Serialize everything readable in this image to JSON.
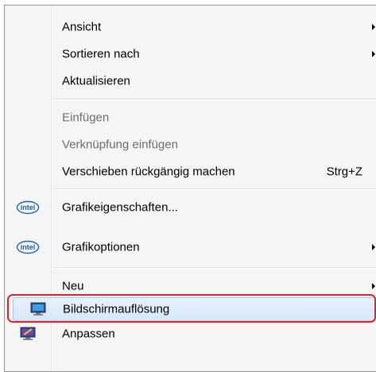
{
  "menu": {
    "items": [
      {
        "label": "Ansicht",
        "submenu": true
      },
      {
        "label": "Sortieren nach",
        "submenu": true
      },
      {
        "label": "Aktualisieren"
      },
      {
        "label": "Einfügen",
        "disabled": true
      },
      {
        "label": "Verknüpfung einfügen",
        "disabled": true
      },
      {
        "label": "Verschieben rückgängig machen",
        "shortcut": "Strg+Z"
      },
      {
        "label": "Grafikeigenschaften...",
        "icon": "intel-icon",
        "icon_text": "intel"
      },
      {
        "label": "Grafikoptionen",
        "icon": "intel-icon",
        "icon_text": "intel",
        "submenu": true
      },
      {
        "label": "Neu",
        "submenu": true
      },
      {
        "label": "Bildschirmauflösung",
        "icon": "monitor-icon",
        "highlighted": true
      },
      {
        "label": "Anpassen",
        "icon": "monitor-paint-icon"
      }
    ]
  },
  "colors": {
    "highlight_ring": "#e0242c",
    "hover_fill": "#d6e8f9",
    "disabled_text": "#6d6d6d",
    "intel_blue": "#1a5fb4"
  }
}
